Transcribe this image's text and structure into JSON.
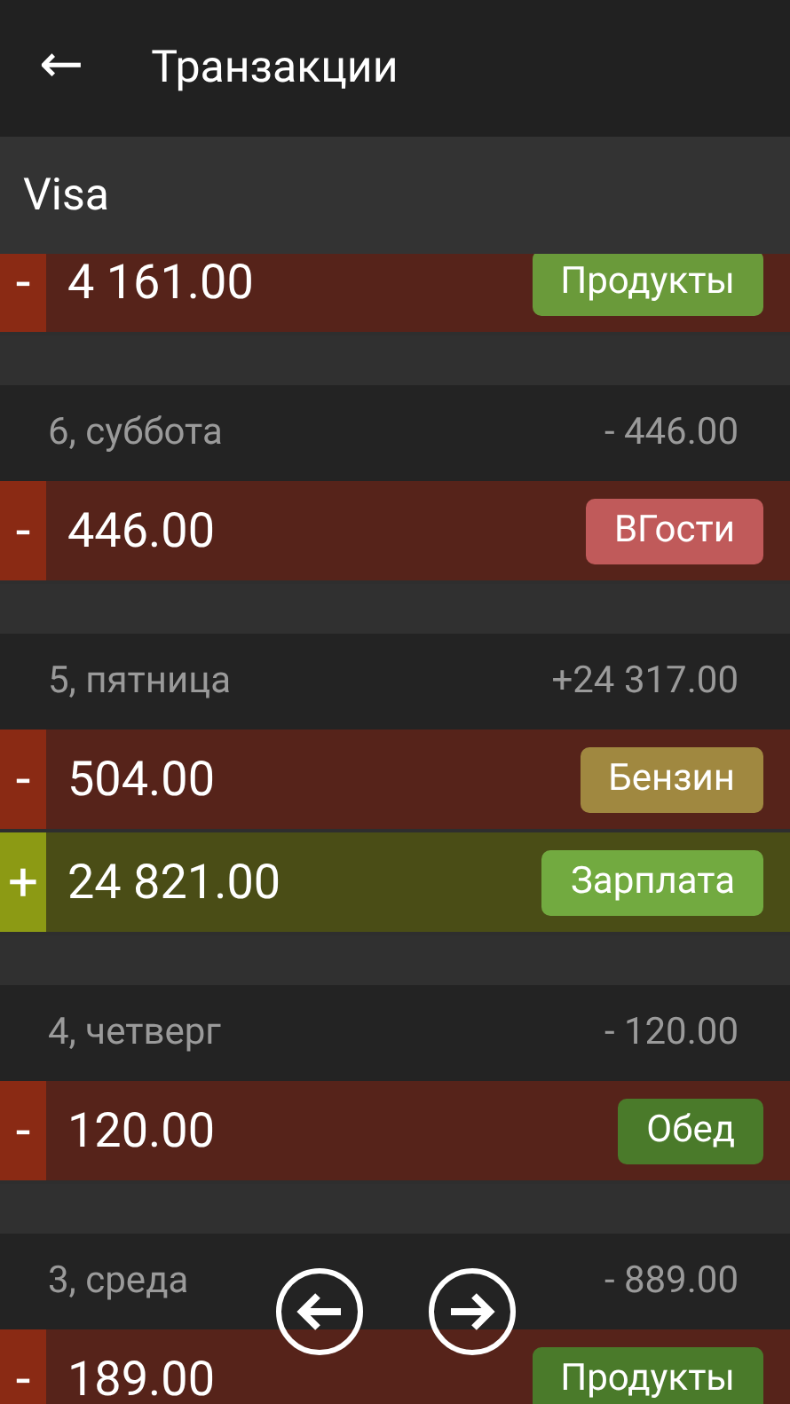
{
  "app_bar": {
    "back_icon": "←",
    "title": "Транзакции"
  },
  "account": {
    "name": "Visa"
  },
  "days": [
    {
      "transactions": [
        {
          "kind": "expense",
          "sign": "-",
          "amount": "4 161.00",
          "category": {
            "label": "Продукты",
            "color": "#6a9a3a"
          }
        }
      ]
    },
    {
      "label": "6, суббота",
      "total": "- 446.00",
      "transactions": [
        {
          "kind": "expense",
          "sign": "-",
          "amount": "446.00",
          "category": {
            "label": "ВГости",
            "color": "#c05a5a"
          }
        }
      ]
    },
    {
      "label": "5, пятница",
      "total": "+24 317.00",
      "transactions": [
        {
          "kind": "expense",
          "sign": "-",
          "amount": "504.00",
          "category": {
            "label": "Бензин",
            "color": "#a08840"
          }
        },
        {
          "kind": "income",
          "sign": "+",
          "amount": "24 821.00",
          "category": {
            "label": "Зарплата",
            "color": "#72aa40"
          }
        }
      ]
    },
    {
      "label": "4, четверг",
      "total": "- 120.00",
      "transactions": [
        {
          "kind": "expense",
          "sign": "-",
          "amount": "120.00",
          "category": {
            "label": "Обед",
            "color": "#4a7a2a"
          }
        }
      ]
    },
    {
      "label": "3, среда",
      "total": "- 889.00",
      "transactions": [
        {
          "kind": "expense",
          "sign": "-",
          "amount": "189.00",
          "category": {
            "label": "Продукты",
            "color": "#4a7a2a"
          }
        }
      ]
    }
  ]
}
